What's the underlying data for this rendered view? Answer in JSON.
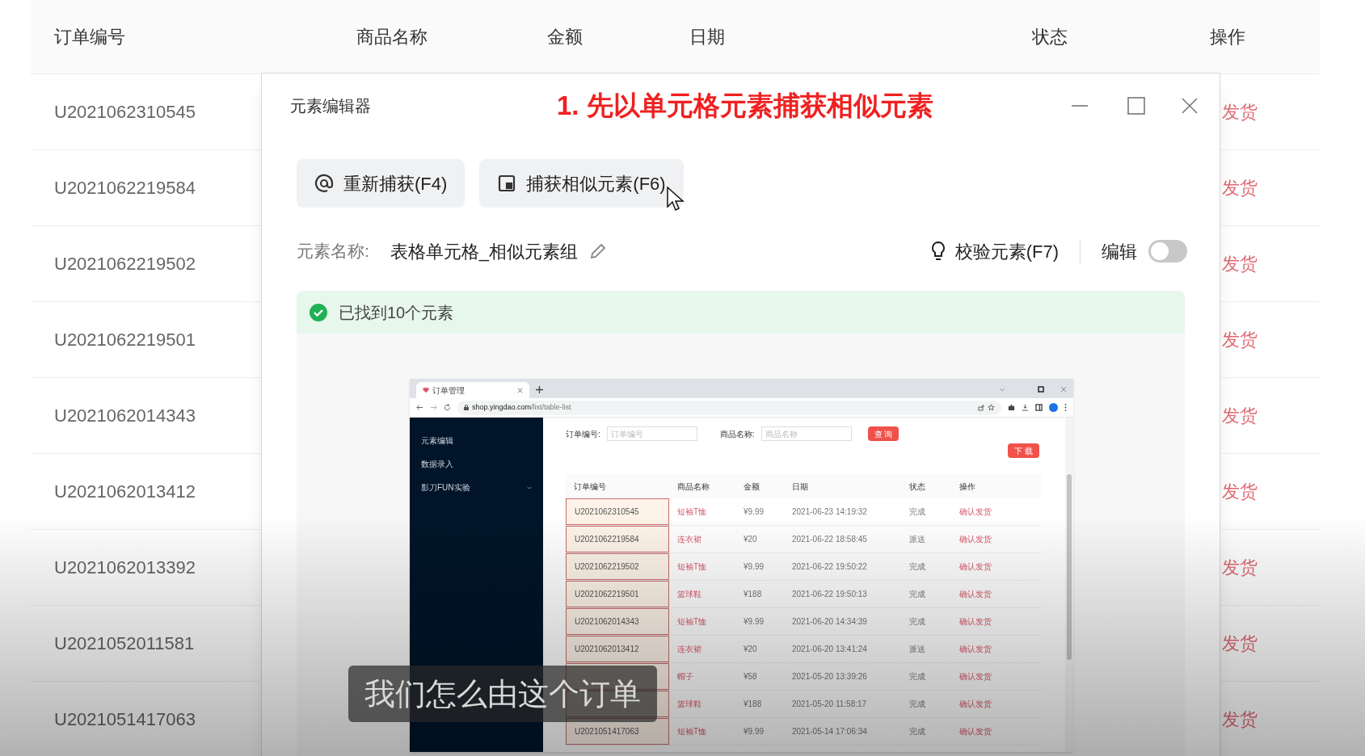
{
  "background_table": {
    "columns": [
      "订单编号",
      "商品名称",
      "金额",
      "日期",
      "状态",
      "操作"
    ],
    "rows": [
      {
        "order_id": "U2021062310545",
        "action": "发货"
      },
      {
        "order_id": "U2021062219584",
        "action": "发货"
      },
      {
        "order_id": "U2021062219502",
        "action": "发货"
      },
      {
        "order_id": "U2021062219501",
        "action": "发货"
      },
      {
        "order_id": "U2021062014343",
        "action": "发货"
      },
      {
        "order_id": "U2021062013412",
        "action": "发货"
      },
      {
        "order_id": "U2021062013392",
        "action": "发货"
      },
      {
        "order_id": "U2021052011581",
        "action": "发货"
      },
      {
        "order_id": "U2021051417063",
        "action": "发货"
      }
    ]
  },
  "dialog": {
    "title": "元素编辑器",
    "annotation": "1. 先以单元格元素捕获相似元素",
    "buttons": [
      {
        "kind": "recapture",
        "label": "重新捕获(F4)"
      },
      {
        "kind": "similar",
        "label": "捕获相似元素(F6)"
      }
    ],
    "name_label": "元素名称:",
    "name_value": "表格单元格_相似元素组",
    "verify_button": "校验元素(F7)",
    "edit_label": "编辑",
    "edit_on": false,
    "result": "已找到10个元素",
    "preview": {
      "tab_title": "订单管理",
      "url_host": "shop.yingdao.com",
      "url_path": "/list/table-list",
      "sidebar": [
        {
          "label": "元素编辑",
          "expandable": false
        },
        {
          "label": "数据录入",
          "expandable": false
        },
        {
          "label": "影刀FUN实验",
          "expandable": true
        }
      ],
      "filters": [
        {
          "label": "订单编号:",
          "placeholder": "订单编号"
        },
        {
          "label": "商品名称:",
          "placeholder": "商品名称"
        }
      ],
      "query_button": "查 询",
      "download_button": "下 载",
      "columns": [
        "订单编号",
        "商品名称",
        "金额",
        "日期",
        "状态",
        "操作"
      ],
      "rows": [
        {
          "order_id": "U2021062310545",
          "product": "短袖T恤",
          "amount": "¥9.99",
          "date": "2021-06-23 14:19:32",
          "status": "完成",
          "action": "确认发货",
          "highlighted": true
        },
        {
          "order_id": "U2021062219584",
          "product": "连衣裙",
          "amount": "¥20",
          "date": "2021-06-22 18:58:45",
          "status": "派送",
          "action": "确认发货",
          "highlighted": true
        },
        {
          "order_id": "U2021062219502",
          "product": "短袖T恤",
          "amount": "¥9.99",
          "date": "2021-06-22 19:50:22",
          "status": "完成",
          "action": "确认发货",
          "highlighted": true
        },
        {
          "order_id": "U2021062219501",
          "product": "篮球鞋",
          "amount": "¥188",
          "date": "2021-06-22 19:50:13",
          "status": "完成",
          "action": "确认发货",
          "highlighted": true
        },
        {
          "order_id": "U2021062014343",
          "product": "短袖T恤",
          "amount": "¥9.99",
          "date": "2021-06-20 14:34:39",
          "status": "完成",
          "action": "确认发货",
          "highlighted": true
        },
        {
          "order_id": "U2021062013412",
          "product": "连衣裙",
          "amount": "¥20",
          "date": "2021-06-20 13:41:24",
          "status": "派送",
          "action": "确认发货",
          "highlighted": true
        },
        {
          "product": "帽子",
          "amount": "¥58",
          "date": "2021-05-20 13:39:26",
          "status": "完成",
          "action": "确认发货",
          "highlighted": true
        },
        {
          "product": "篮球鞋",
          "amount": "¥188",
          "date": "2021-05-20 11:58:17",
          "status": "完成",
          "action": "确认发货",
          "highlighted": true
        },
        {
          "order_id": "U2021051417063",
          "product": "短袖T恤",
          "amount": "¥9.99",
          "date": "2021-05-14 17:06:34",
          "status": "完成",
          "action": "确认发货",
          "highlighted": true
        }
      ]
    }
  },
  "caption": "我们怎么由这个订单"
}
